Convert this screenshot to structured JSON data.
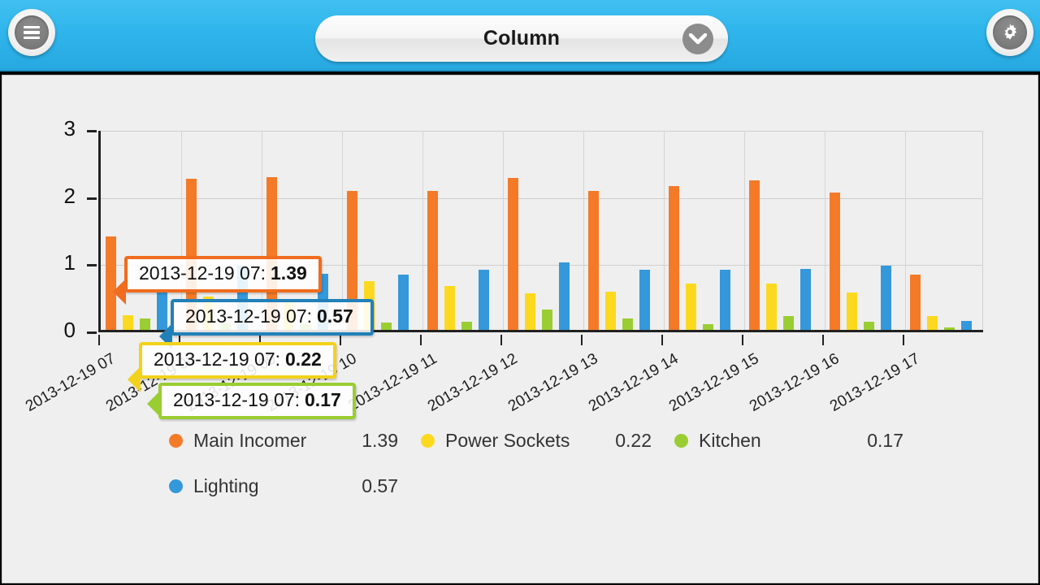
{
  "header": {
    "menu_icon": "hamburger-menu-icon",
    "title": "Column",
    "dropdown_icon": "chevron-down-icon",
    "settings_icon": "gear-icon"
  },
  "colors": {
    "header_bg": "#2fb5ec",
    "panel_bg": "#efeff0",
    "main_incomer": "#F47A28",
    "power_sockets": "#FCD91F",
    "kitchen": "#9ACD32",
    "lighting": "#3498DB"
  },
  "chart_data": {
    "type": "bar",
    "title": "",
    "xlabel": "",
    "ylabel": "",
    "ylim": [
      0,
      3
    ],
    "yticks": [
      0,
      1,
      2,
      3
    ],
    "grid": true,
    "legend_position": "bottom",
    "categories": [
      "2013-12-19 07",
      "2013-12-19 08",
      "2013-12-19 09",
      "2013-12-19 10",
      "2013-12-19 11",
      "2013-12-19 12",
      "2013-12-19 13",
      "2013-12-19 14",
      "2013-12-19 15",
      "2013-12-19 16",
      "2013-12-19 17"
    ],
    "series": [
      {
        "name": "Main Incomer",
        "color": "#F47A28",
        "values": [
          1.39,
          2.25,
          2.28,
          2.07,
          2.07,
          2.26,
          2.07,
          2.14,
          2.22,
          2.05,
          0.82
        ]
      },
      {
        "name": "Power Sockets",
        "color": "#FCD91F",
        "values": [
          0.22,
          0.5,
          0.46,
          0.72,
          0.65,
          0.55,
          0.57,
          0.69,
          0.69,
          0.56,
          0.2
        ]
      },
      {
        "name": "Kitchen",
        "color": "#9ACD32",
        "values": [
          0.17,
          0.1,
          0.09,
          0.11,
          0.12,
          0.3,
          0.17,
          0.09,
          0.2,
          0.12,
          0.04
        ]
      },
      {
        "name": "Lighting",
        "color": "#3498DB",
        "values": [
          0.57,
          0.95,
          0.83,
          0.82,
          0.89,
          1.0,
          0.89,
          0.89,
          0.91,
          0.95,
          0.13
        ]
      }
    ],
    "tooltips": [
      {
        "label": "2013-12-19 07:",
        "value": "1.39",
        "color": "#F06C1E",
        "series": "Main Incomer"
      },
      {
        "label": "2013-12-19 07:",
        "value": "0.57",
        "color": "#2280B8",
        "series": "Lighting"
      },
      {
        "label": "2013-12-19 07:",
        "value": "0.22",
        "color": "#F2D21B",
        "series": "Power Sockets"
      },
      {
        "label": "2013-12-19 07:",
        "value": "0.17",
        "color": "#9ACD32",
        "series": "Kitchen"
      }
    ]
  },
  "legend": {
    "row1": [
      {
        "name": "Main Incomer",
        "value": "1.39",
        "color": "#F47A28"
      },
      {
        "name": "Power Sockets",
        "value": "0.22",
        "color": "#FCD91F"
      },
      {
        "name": "Kitchen",
        "value": "0.17",
        "color": "#9ACD32"
      }
    ],
    "row2": [
      {
        "name": "Lighting",
        "value": "0.57",
        "color": "#3498DB"
      }
    ]
  }
}
